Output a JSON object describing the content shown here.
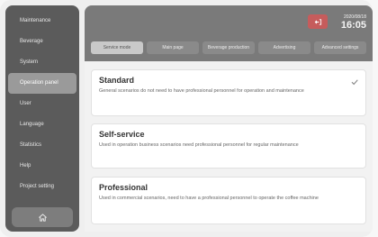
{
  "sidebar": {
    "items": [
      {
        "label": "Maintenance",
        "active": false
      },
      {
        "label": "Beverage",
        "active": false
      },
      {
        "label": "System",
        "active": false
      },
      {
        "label": "Operation panel",
        "active": true
      },
      {
        "label": "User",
        "active": false
      },
      {
        "label": "Language",
        "active": false
      },
      {
        "label": "Statistics",
        "active": false
      },
      {
        "label": "Help",
        "active": false
      },
      {
        "label": "Project setting",
        "active": false
      }
    ],
    "home_icon": "home-icon"
  },
  "header": {
    "date": "2020/08/18",
    "time": "16:05",
    "action_icon": "return-icon",
    "action_color": "#c65c5c"
  },
  "tabs": [
    {
      "label": "Service mode",
      "active": true
    },
    {
      "label": "Main page",
      "active": false
    },
    {
      "label": "Beverage production",
      "active": false
    },
    {
      "label": "Advertising",
      "active": false
    },
    {
      "label": "Advanced settings",
      "active": false
    }
  ],
  "modes": [
    {
      "title": "Standard",
      "description": "General scenarios do not need to have professional personnel for operation and maintenance",
      "selected": true
    },
    {
      "title": "Self-service",
      "description": "Used in operation business scenarios need professional personnel for regular maintenance",
      "selected": false
    },
    {
      "title": "Professional",
      "description": "Used in commercial scenarios, need to have a professional personnel to operate the coffee machine",
      "selected": false
    }
  ]
}
